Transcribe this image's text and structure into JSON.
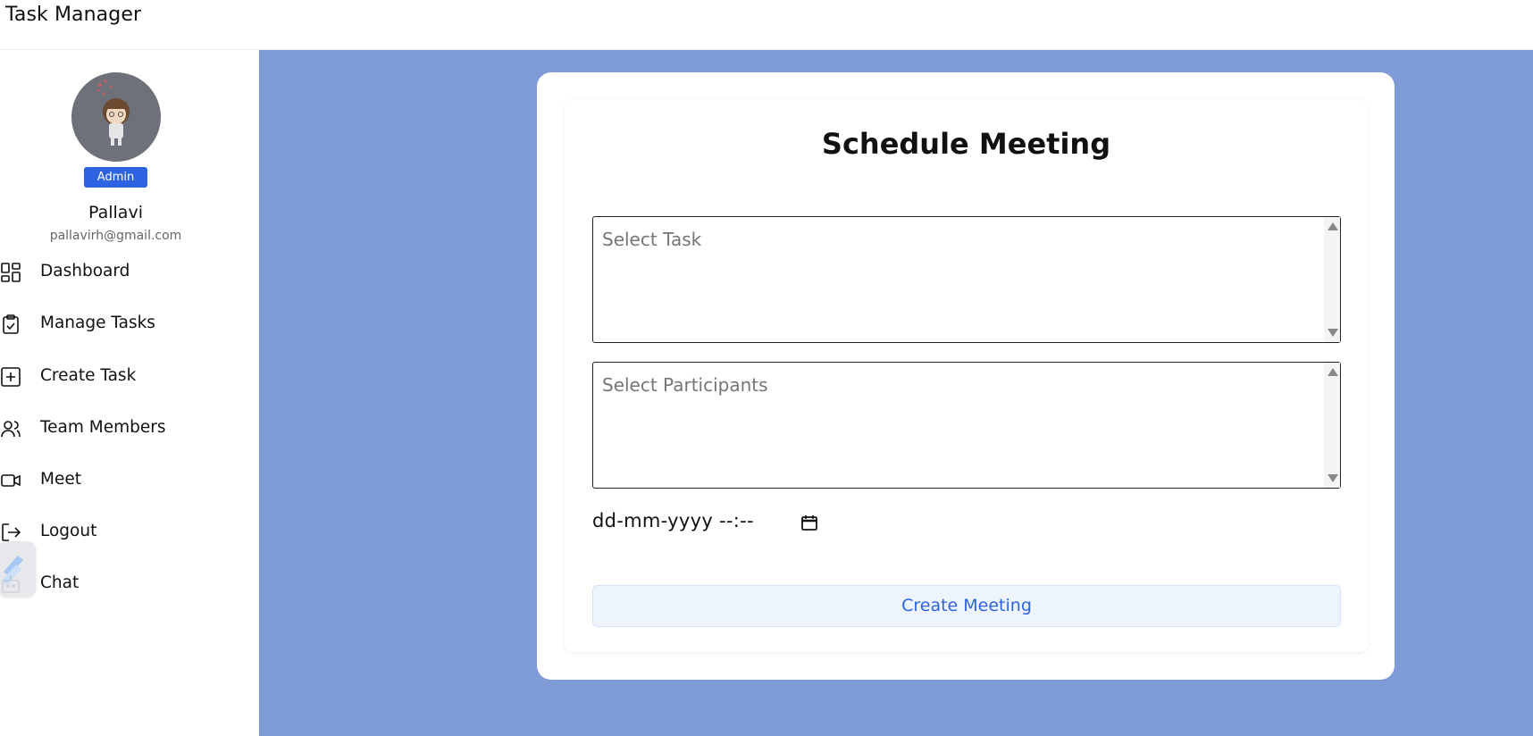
{
  "app": {
    "title": "Task Manager"
  },
  "profile": {
    "role": "Admin",
    "name": "Pallavi",
    "email": "pallavirh@gmail.com"
  },
  "sidebar": {
    "items": [
      {
        "label": "Dashboard",
        "icon": "dashboard-icon"
      },
      {
        "label": "Manage Tasks",
        "icon": "clipboard-check-icon"
      },
      {
        "label": "Create Task",
        "icon": "plus-square-icon"
      },
      {
        "label": "Team Members",
        "icon": "users-icon"
      },
      {
        "label": "Meet",
        "icon": "video-icon"
      },
      {
        "label": "Logout",
        "icon": "logout-icon"
      },
      {
        "label": "Chat",
        "icon": "bot-icon"
      }
    ]
  },
  "form": {
    "title": "Schedule Meeting",
    "task_select_placeholder": "Select Task",
    "participants_select_placeholder": "Select Participants",
    "datetime_value": "dd-mm-yyyy --:--",
    "submit_label": "Create Meeting"
  },
  "colors": {
    "main_background": "#7e9bd5",
    "accent": "#2d63e0",
    "button_background": "#eef4fc"
  }
}
